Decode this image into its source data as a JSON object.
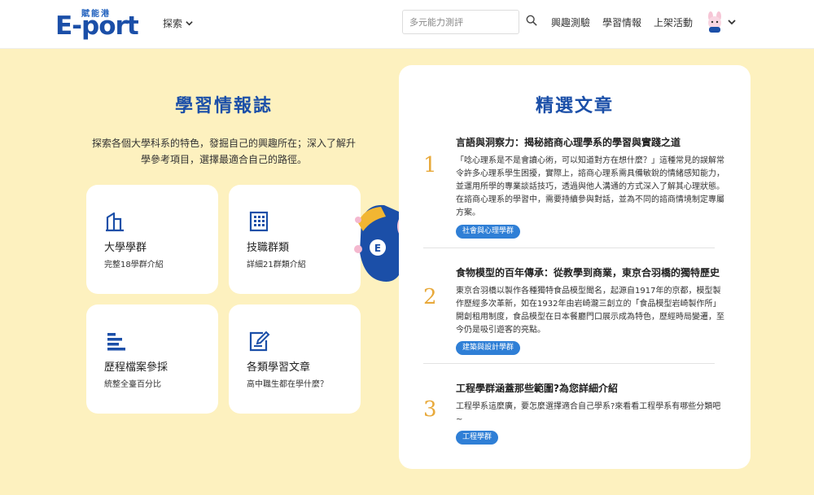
{
  "header": {
    "logo_tag": "賦能港",
    "logo_word": "E-port",
    "explore_label": "探索",
    "search_placeholder": "多元能力測評",
    "nav": [
      "興趣測驗",
      "學習情報",
      "上架活動"
    ]
  },
  "left": {
    "title": "學習情報誌",
    "desc_line1": "探索各個大學科系的特色，發掘自己的興趣所在；深入了解升",
    "desc_line2": "學參考項目，選擇最適合自己的路徑。",
    "cards": [
      {
        "title": "大學學群",
        "sub": "完整18學群介紹",
        "icon": "university-icon"
      },
      {
        "title": "技職群類",
        "sub": "詳細21群類介紹",
        "icon": "building-icon"
      },
      {
        "title": "歷程檔案參採",
        "sub": "統整全臺百分比",
        "icon": "bar-list-icon"
      },
      {
        "title": "各類學習文章",
        "sub": "高中職生都在學什麼？",
        "icon": "edit-note-icon"
      }
    ]
  },
  "right": {
    "title": "精選文章",
    "articles": [
      {
        "num": "1",
        "title": "言語與洞察力：揭秘諮商心理學系的學習與實踐之道",
        "body": "「唸心理系是不是會讀心術，可以知道對方在想什麼？」這種常見的誤解常令許多心理系學生困擾，實際上，諮商心理系需具備敏銳的情緒感知能力，並運用所學的專業談話技巧，透過與他人溝通的方式深入了解其心理狀態。在諮商心理系的學習中，需要持續參與對話，並為不同的諮商情境制定專屬方案。",
        "tag": "社會與心理學群"
      },
      {
        "num": "2",
        "title": "食物模型的百年傳承：從教學到商業，東京合羽橋的獨特歷史",
        "body": "東京合羽橋以製作各種獨特食品模型聞名，起源自1917年的京都，模型製作歷經多次革新，如在1932年由岩崎瀧三創立的「食品模型岩崎製作所」開創租用制度，食品模型在日本餐廳門口展示成為特色，歷經時局變遷，至今仍是吸引遊客的亮點。",
        "tag": "建築與設計學群"
      },
      {
        "num": "3",
        "title": "工程學群涵蓋那些範圍?為您詳細介紹",
        "body": "工程學系這麼廣，要怎麼選擇適合自己學系?來看看工程學系有哪些分類吧~",
        "tag": "工程學群"
      }
    ]
  },
  "colors": {
    "brand_blue": "#1b4fa8",
    "tag_blue": "#2f7fd6",
    "number_orange": "#e8a93b",
    "background_yellow": "#fdf1bf"
  }
}
